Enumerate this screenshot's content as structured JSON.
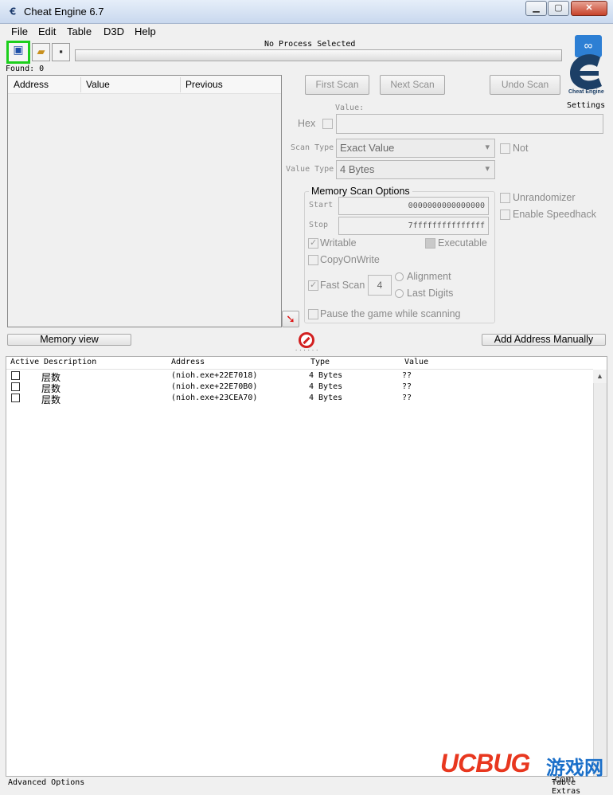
{
  "window": {
    "title": "Cheat Engine 6.7",
    "minimize": "▁",
    "maximize": "▢",
    "close": "✕"
  },
  "menu": [
    "File",
    "Edit",
    "Table",
    "D3D",
    "Help"
  ],
  "toolbar": {
    "process_label": "No Process Selected",
    "found_label": "Found: 0"
  },
  "found_list": {
    "columns": [
      "Address",
      "Value",
      "Previous"
    ]
  },
  "scan": {
    "first_scan": "First Scan",
    "next_scan": "Next Scan",
    "undo_scan": "Undo Scan",
    "settings": "Settings",
    "logo_text": "Cheat Engine",
    "value_label": "Value:",
    "hex_label": "Hex",
    "scan_type_label": "Scan Type",
    "scan_type_value": "Exact Value",
    "value_type_label": "Value Type",
    "value_type_value": "4 Bytes",
    "not_label": "Not"
  },
  "memory_options": {
    "title": "Memory Scan Options",
    "start_label": "Start",
    "start_value": "0000000000000000",
    "stop_label": "Stop",
    "stop_value": "7fffffffffffffff",
    "writable": "Writable",
    "executable": "Executable",
    "copy_on_write": "CopyOnWrite",
    "fast_scan": "Fast Scan",
    "fast_scan_value": "4",
    "alignment": "Alignment",
    "last_digits": "Last Digits",
    "pause_game": "Pause the game while scanning",
    "unrandomizer": "Unrandomizer",
    "enable_speedhack": "Enable Speedhack"
  },
  "actions": {
    "memory_view": "Memory view",
    "add_address": "Add Address Manually",
    "splitter": "......"
  },
  "table": {
    "columns": [
      "Active",
      "Description",
      "Address",
      "Type",
      "Value"
    ],
    "rows": [
      {
        "description": "层数",
        "address": "(nioh.exe+22E7018)",
        "type": "4 Bytes",
        "value": "??"
      },
      {
        "description": "层数",
        "address": "(nioh.exe+22E70B0)",
        "type": "4 Bytes",
        "value": "??"
      },
      {
        "description": "层数",
        "address": "(nioh.exe+23CEA70)",
        "type": "4 Bytes",
        "value": "??"
      }
    ]
  },
  "status": {
    "advanced_options": "Advanced Options",
    "table_extras": "Table Extras"
  },
  "watermark": {
    "brand": "UCBUG",
    "cn": "游戏网",
    "dotcom": ".com"
  },
  "colors": {
    "accent_green": "#1ccf1c",
    "watermark_red": "#e8371f",
    "watermark_blue": "#1a6fc9"
  }
}
